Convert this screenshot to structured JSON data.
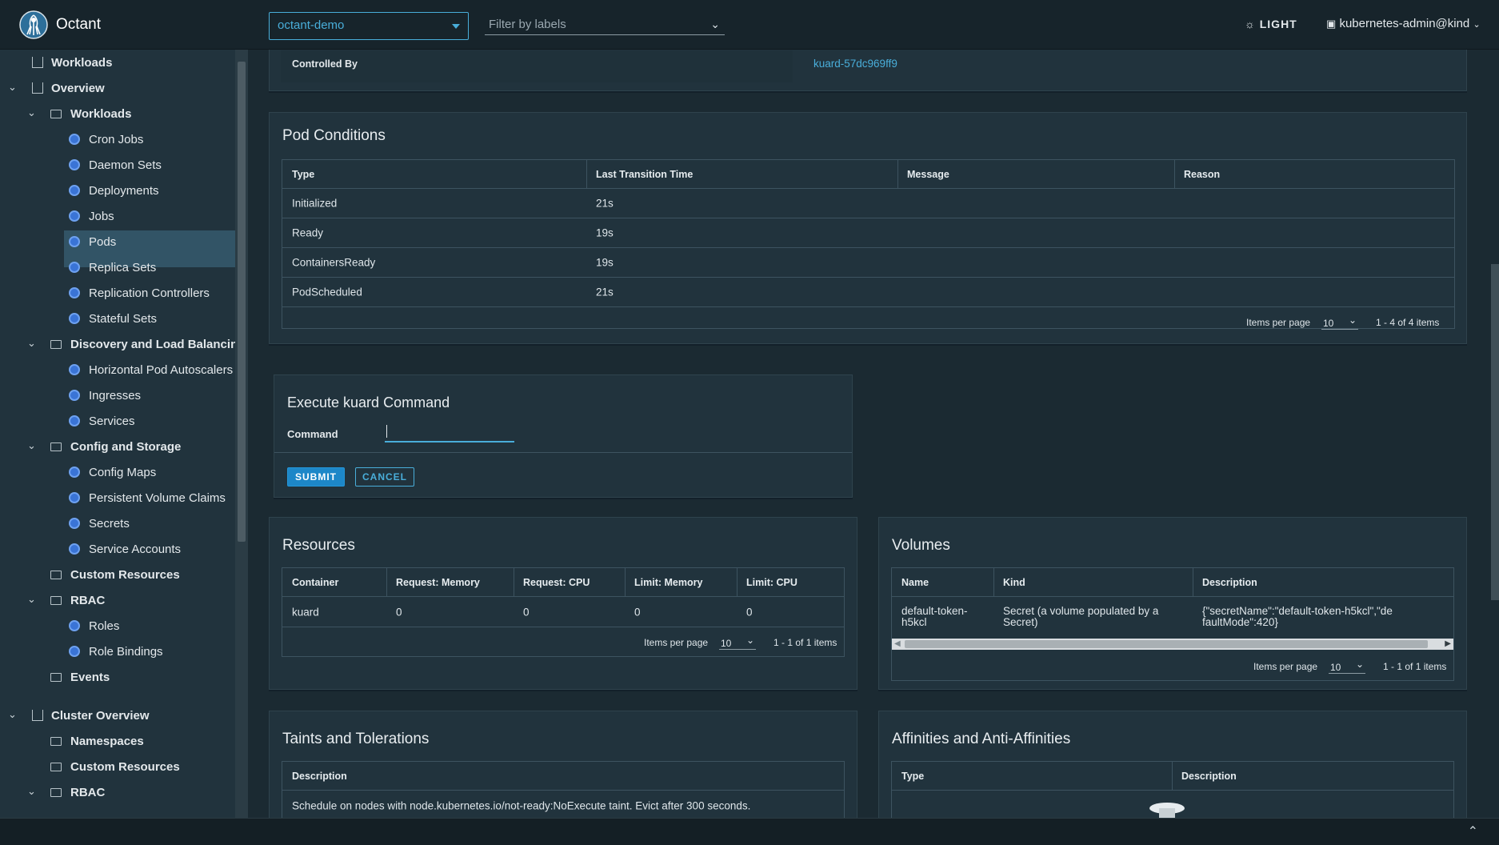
{
  "header": {
    "brand": "Octant",
    "namespace": "octant-demo",
    "label_filter_placeholder": "Filter by labels",
    "theme_label": "LIGHT",
    "user": "kubernetes-admin@kind"
  },
  "sidebar": {
    "workloads_top": "Workloads",
    "overview": "Overview",
    "workloads": "Workloads",
    "cron_jobs": "Cron Jobs",
    "daemon_sets": "Daemon Sets",
    "deployments": "Deployments",
    "jobs": "Jobs",
    "pods": "Pods",
    "replica_sets": "Replica Sets",
    "replication_controllers": "Replication Controllers",
    "stateful_sets": "Stateful Sets",
    "discovery": "Discovery and Load Balancing",
    "hpa": "Horizontal Pod Autoscalers",
    "ingresses": "Ingresses",
    "services": "Services",
    "config_storage": "Config and Storage",
    "config_maps": "Config Maps",
    "pvc": "Persistent Volume Claims",
    "secrets": "Secrets",
    "service_accounts": "Service Accounts",
    "custom_resources": "Custom Resources",
    "rbac": "RBAC",
    "roles": "Roles",
    "role_bindings": "Role Bindings",
    "events": "Events",
    "cluster_overview": "Cluster Overview",
    "namespaces": "Namespaces",
    "cluster_custom_resources": "Custom Resources",
    "cluster_rbac": "RBAC"
  },
  "controlled_by": {
    "label": "Controlled By",
    "value": "kuard-57dc969ff9"
  },
  "pod_conditions": {
    "title": "Pod Conditions",
    "columns": [
      "Type",
      "Last Transition Time",
      "Message",
      "Reason"
    ],
    "rows": [
      [
        "Initialized",
        "21s",
        "",
        ""
      ],
      [
        "Ready",
        "19s",
        "",
        ""
      ],
      [
        "ContainersReady",
        "19s",
        "",
        ""
      ],
      [
        "PodScheduled",
        "21s",
        "",
        ""
      ]
    ],
    "items_per_page_label": "Items per page",
    "per_page": "10",
    "range": "1 - 4 of 4 items"
  },
  "exec": {
    "title": "Execute kuard Command",
    "command_label": "Command",
    "command_value": "",
    "submit": "SUBMIT",
    "cancel": "CANCEL"
  },
  "resources": {
    "title": "Resources",
    "columns": [
      "Container",
      "Request: Memory",
      "Request: CPU",
      "Limit: Memory",
      "Limit: CPU"
    ],
    "rows": [
      [
        "kuard",
        "0",
        "0",
        "0",
        "0"
      ]
    ],
    "items_per_page_label": "Items per page",
    "per_page": "10",
    "range": "1 - 1 of 1 items"
  },
  "volumes": {
    "title": "Volumes",
    "columns": [
      "Name",
      "Kind",
      "Description"
    ],
    "rows": [
      [
        "default-token-h5kcl",
        "Secret (a volume populated by a Secret)",
        "{\"secretName\":\"default-token-h5kcl\",\"defaultMode\":420}"
      ]
    ],
    "items_per_page_label": "Items per page",
    "per_page": "10",
    "range": "1 - 1 of 1 items"
  },
  "taints": {
    "title": "Taints and Tolerations",
    "column": "Description",
    "row": "Schedule on nodes with node.kubernetes.io/not-ready:NoExecute taint. Evict after 300 seconds."
  },
  "affinities": {
    "title": "Affinities and Anti-Affinities",
    "columns": [
      "Type",
      "Description"
    ]
  },
  "colors": {
    "accent": "#49aeda",
    "background": "#1b2a32",
    "panel": "#21333d",
    "sidebar_active": "#325466"
  }
}
